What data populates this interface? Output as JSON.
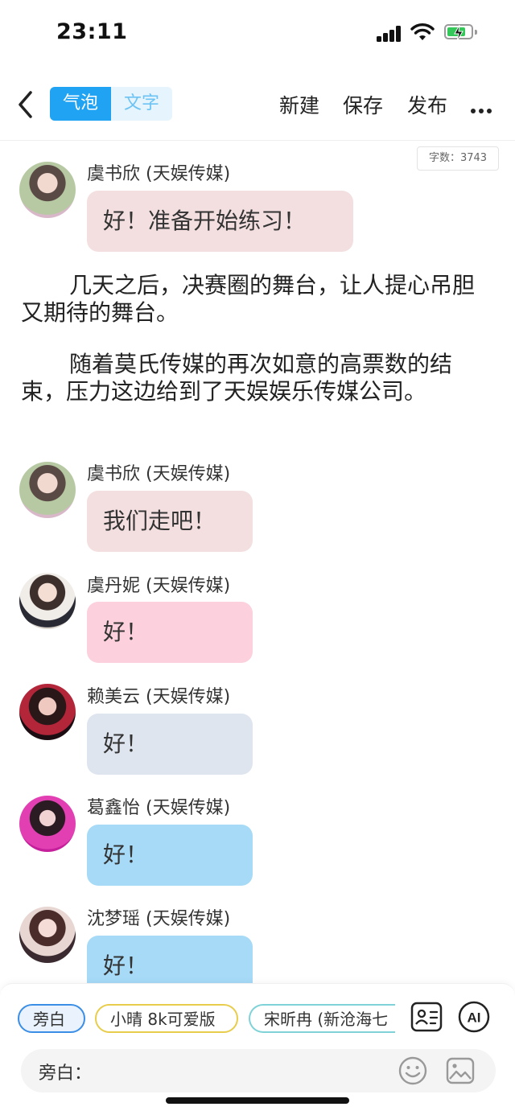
{
  "status": {
    "time": "23:11"
  },
  "nav": {
    "mode_bubble": "气泡",
    "mode_text": "文字",
    "new": "新建",
    "save": "保存",
    "publish": "发布"
  },
  "word_count": "字数：3743",
  "messages": [
    {
      "sender": "虞书欣 (天娱传媒)",
      "text": "好！准备开始练习！",
      "bubble_color": "#f3dfe0"
    },
    {
      "sender": "虞书欣 (天娱传媒)",
      "text": "我们走吧！",
      "bubble_color": "#f3dfe0"
    },
    {
      "sender": "虞丹妮 (天娱传媒)",
      "text": "好！",
      "bubble_color": "#fcd0dd"
    },
    {
      "sender": "赖美云 (天娱传媒)",
      "text": "好！",
      "bubble_color": "#dfe5ee"
    },
    {
      "sender": "葛鑫怡 (天娱传媒)",
      "text": "好！",
      "bubble_color": "#a6daf7"
    },
    {
      "sender": "沈梦瑶 (天娱传媒)",
      "text": "好！",
      "bubble_color": "#a6daf7"
    }
  ],
  "narration": [
    "几天之后，决赛圈的舞台，让人提心吊胆又期待的舞台。",
    "随着莫氏传媒的再次如意的高票数的结束，压力这边给到了天娱娱乐传媒公司。"
  ],
  "roles": [
    "旁白",
    "小晴 8k可爱版",
    "宋昕冉 (新沧海七"
  ],
  "input": {
    "label": "旁白：",
    "placeholder": ""
  },
  "icons": {
    "back": "chevron-left-icon",
    "more": "more-icon",
    "contact": "contact-card-icon",
    "ai": "ai-icon",
    "emoji": "emoji-icon",
    "image": "image-icon"
  },
  "colors": {
    "accent": "#1fa3f2"
  }
}
